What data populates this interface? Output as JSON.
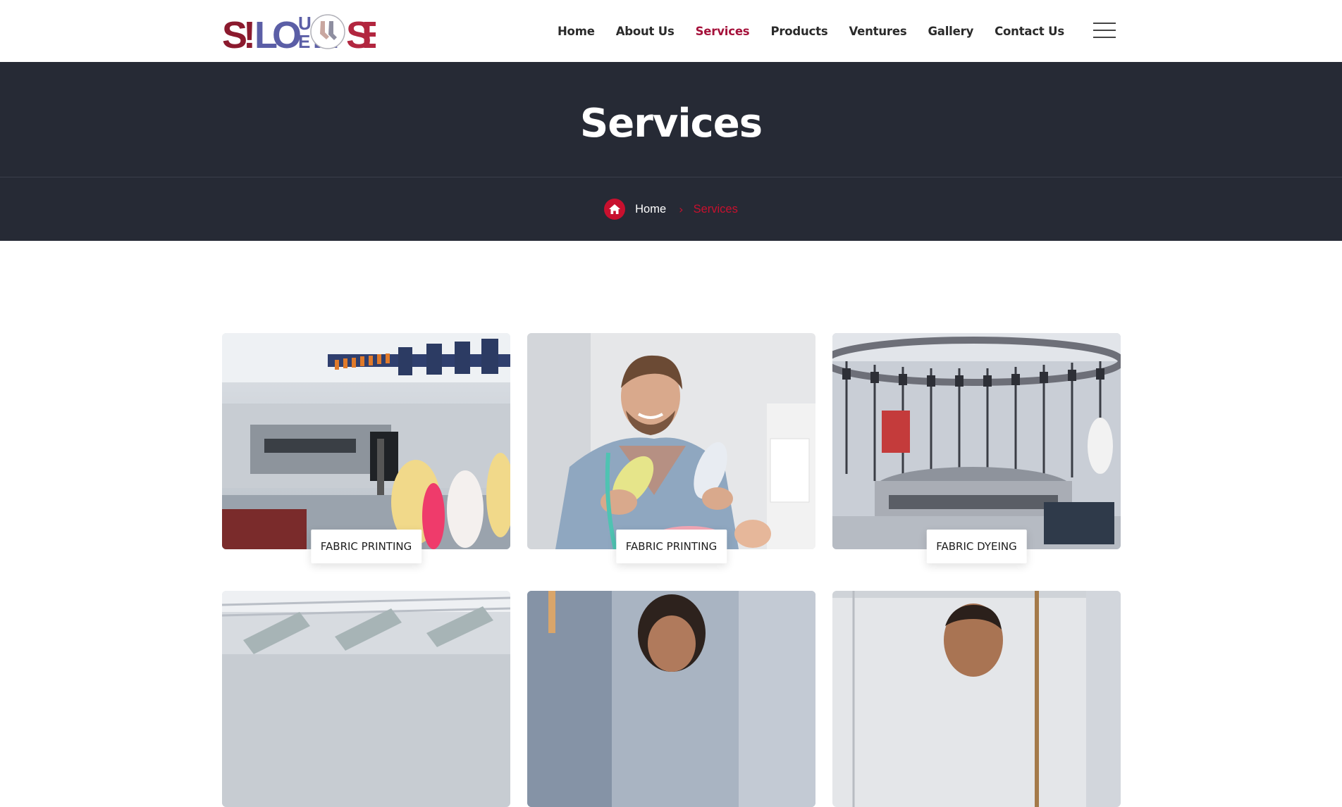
{
  "brand": {
    "logo_text": "S!LOUHOUSE",
    "colors": {
      "primary": "#a5123b",
      "accent": "#c8102e",
      "logo_blue": "#5b5ea6",
      "banner_bg": "#262a35"
    }
  },
  "nav": {
    "items": [
      {
        "label": "Home",
        "active": false
      },
      {
        "label": "About Us",
        "active": false
      },
      {
        "label": "Services",
        "active": true
      },
      {
        "label": "Products",
        "active": false
      },
      {
        "label": "Ventures",
        "active": false
      },
      {
        "label": "Gallery",
        "active": false
      },
      {
        "label": "Contact Us",
        "active": false
      }
    ],
    "menu_icon": "hamburger-icon"
  },
  "banner": {
    "title": "Services",
    "breadcrumb": {
      "home_icon": "home-icon",
      "home_label": "Home",
      "separator": "›",
      "current": "Services"
    }
  },
  "services": [
    {
      "label": "FABRIC PRINTING",
      "image": "thread-cone-machine-photo"
    },
    {
      "label": "FABRIC PRINTING",
      "image": "smiling-man-holding-thread-photo"
    },
    {
      "label": "FABRIC DYEING",
      "image": "circular-knitting-machine-photo"
    },
    {
      "label": "",
      "image": "factory-ceiling-rollers-photo"
    },
    {
      "label": "",
      "image": "woman-worker-photo"
    },
    {
      "label": "",
      "image": "man-worker-photo"
    }
  ]
}
